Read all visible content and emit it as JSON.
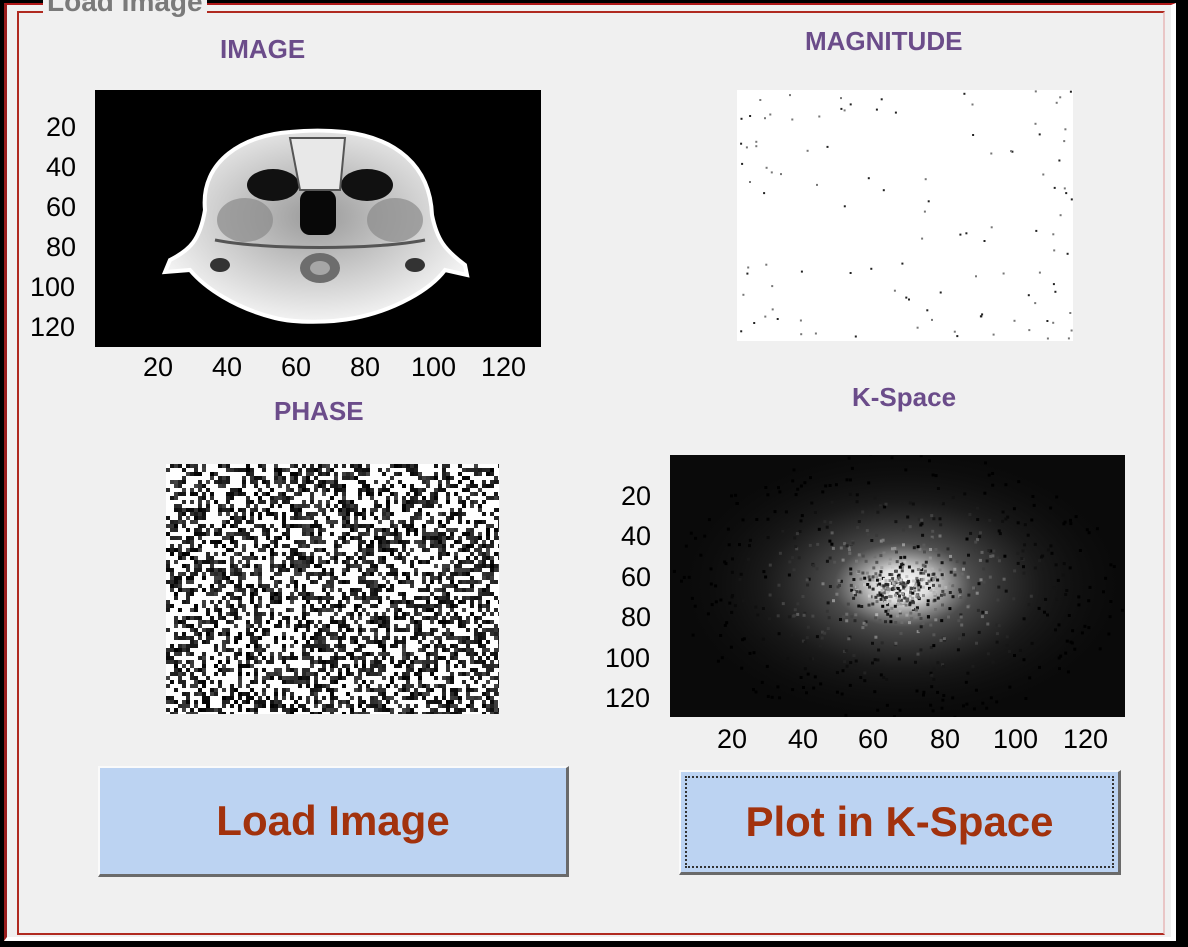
{
  "panel": {
    "title": "Load Image"
  },
  "axes": {
    "image": {
      "title": "IMAGE",
      "yticks": [
        "20",
        "40",
        "60",
        "80",
        "100",
        "120"
      ],
      "xticks": [
        "20",
        "40",
        "60",
        "80",
        "100",
        "120"
      ]
    },
    "magnitude": {
      "title": "MAGNITUDE"
    },
    "phase": {
      "title": "PHASE"
    },
    "kspace": {
      "title": "K-Space",
      "yticks": [
        "20",
        "40",
        "60",
        "80",
        "100",
        "120"
      ],
      "xticks": [
        "20",
        "40",
        "60",
        "80",
        "100",
        "120"
      ]
    }
  },
  "buttons": {
    "load": "Load Image",
    "plot": "Plot in K-Space"
  },
  "colors": {
    "button_bg": "#bcd3f2",
    "button_text": "#a2320d",
    "title_text": "#6b4c8a"
  }
}
